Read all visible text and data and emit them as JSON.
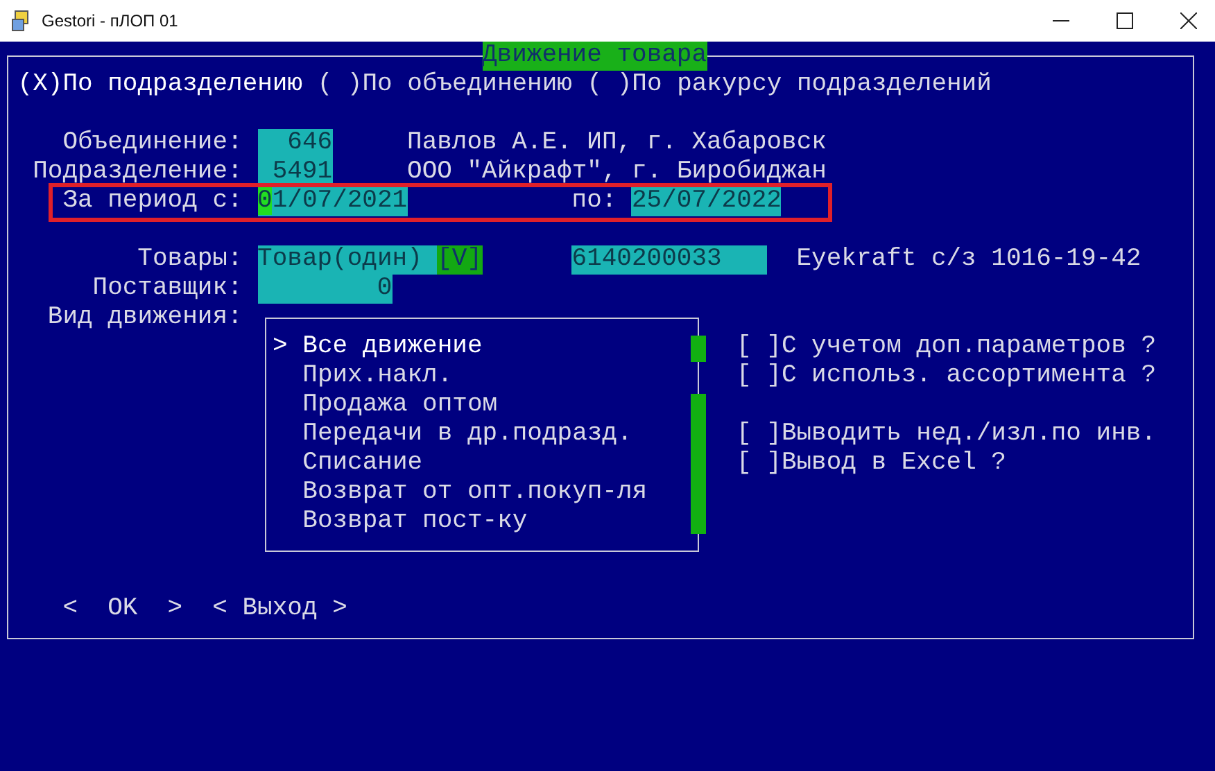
{
  "window": {
    "title": "Gestori - пЛОП 01"
  },
  "dialog": {
    "title": "Движение товара"
  },
  "scope_options": [
    {
      "mark": "(X)",
      "label": "По подразделению",
      "selected": true
    },
    {
      "mark": "( )",
      "label": "По объединению",
      "selected": false
    },
    {
      "mark": "( )",
      "label": "По ракурсу подразделений",
      "selected": false
    }
  ],
  "union": {
    "label": "Объединение:",
    "value": "646",
    "name": "Павлов А.Е. ИП, г. Хабаровск"
  },
  "division": {
    "label": "Подразделение:",
    "value": "5491",
    "name": "ООО \"Айкрафт\", г. Биробиджан"
  },
  "period": {
    "label": "За период с:",
    "from": "01/07/2021",
    "focused": true,
    "to_label": "по:",
    "to": "25/07/2022"
  },
  "goods": {
    "label": "Товары:",
    "mode": "Товар(один)",
    "toggle": "[V]",
    "code": "6140200033",
    "name": "Eyekraft с/з 1016-19-42"
  },
  "supplier": {
    "label": "Поставщик:",
    "value": "0"
  },
  "movement": {
    "label": "Вид движения:",
    "pointer": ">",
    "items": [
      {
        "label": "Все движение",
        "selected": true
      },
      {
        "label": "Прих.накл.",
        "selected": false
      },
      {
        "label": "Продажа оптом",
        "selected": false
      },
      {
        "label": "Передачи в др.подразд.",
        "selected": false
      },
      {
        "label": "Списание",
        "selected": false
      },
      {
        "label": "Возврат от опт.покуп-ля",
        "selected": false
      },
      {
        "label": "Возврат пост-ку",
        "selected": false
      }
    ]
  },
  "option_groups": [
    [
      {
        "mark": "[ ]",
        "label": "С учетом доп.параметров ?",
        "checked": false
      },
      {
        "mark": "[ ]",
        "label": "С использ. ассортимента ?",
        "checked": false
      }
    ],
    [
      {
        "mark": "[ ]",
        "label": "Выводить нед./изл.по инв.",
        "checked": false
      },
      {
        "mark": "[ ]",
        "label": "Вывод в Excel ?",
        "checked": false
      }
    ]
  ],
  "buttons": [
    {
      "label": "<  OK  >"
    },
    {
      "label": "< Выход >"
    }
  ]
}
